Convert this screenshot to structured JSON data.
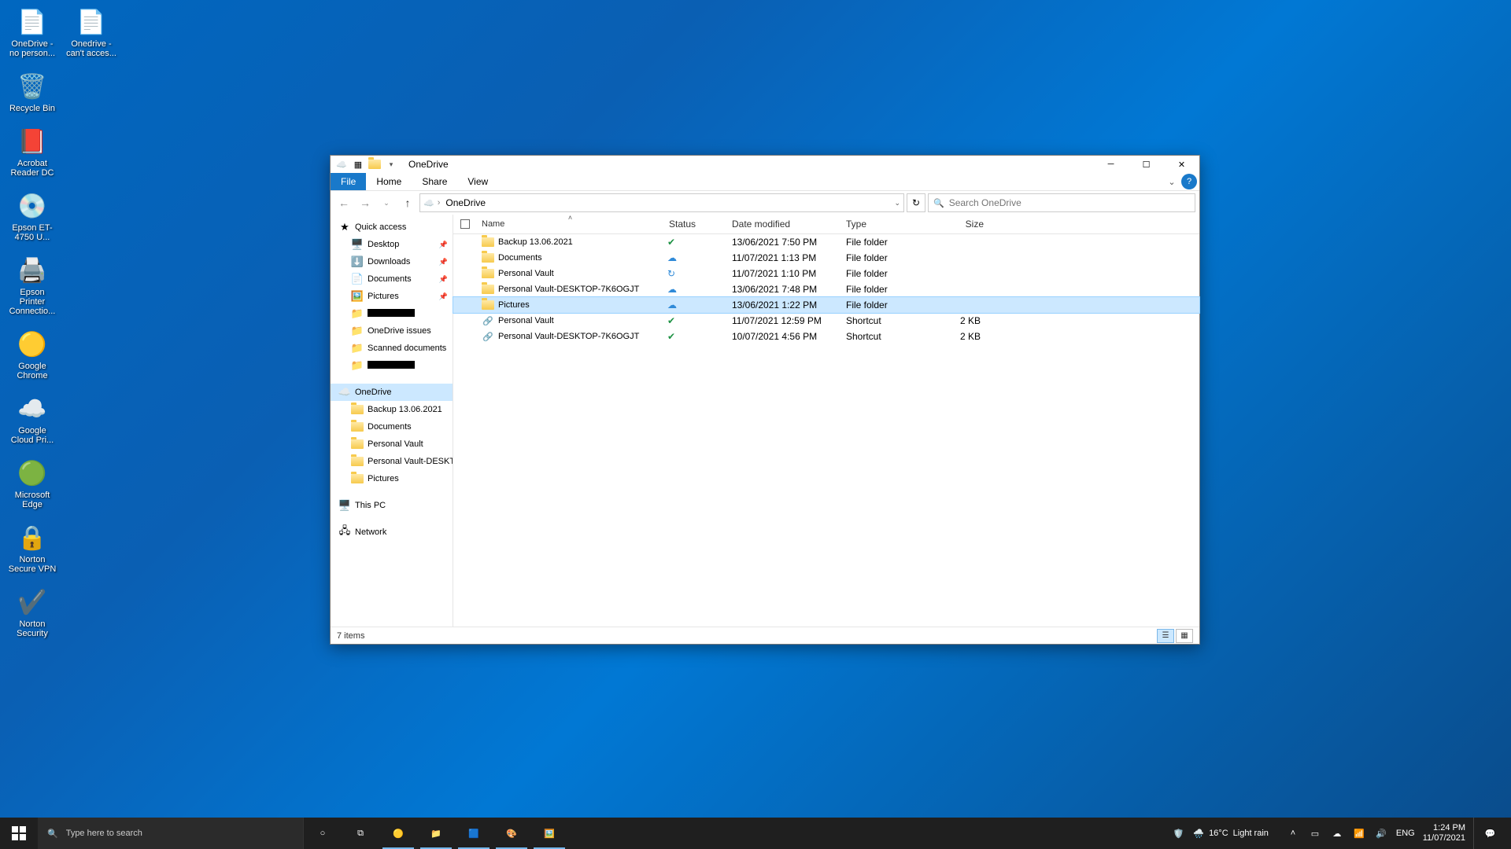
{
  "desktop_icons_col1": [
    {
      "label": "OneDrive - no person...",
      "emoji": "📄"
    },
    {
      "label": "Recycle Bin",
      "emoji": "🗑️"
    },
    {
      "label": "Acrobat Reader DC",
      "emoji": "📕"
    },
    {
      "label": "Epson ET-4750 U...",
      "emoji": "💿"
    },
    {
      "label": "Epson Printer Connectio...",
      "emoji": "🖨️"
    },
    {
      "label": "Google Chrome",
      "emoji": "🟡"
    },
    {
      "label": "Google Cloud Pri...",
      "emoji": "☁️"
    },
    {
      "label": "Microsoft Edge",
      "emoji": "🟢"
    },
    {
      "label": "Norton Secure VPN",
      "emoji": "🔒"
    },
    {
      "label": "Norton Security",
      "emoji": "✔️"
    }
  ],
  "desktop_icons_col2": [
    {
      "label": "Onedrive - can't acces...",
      "emoji": "📄"
    }
  ],
  "window": {
    "title": "OneDrive",
    "tabs": {
      "file": "File",
      "home": "Home",
      "share": "Share",
      "view": "View"
    },
    "breadcrumb": "OneDrive",
    "search_placeholder": "Search OneDrive",
    "columns": {
      "name": "Name",
      "status": "Status",
      "date": "Date modified",
      "type": "Type",
      "size": "Size"
    },
    "rows": [
      {
        "name": "Backup 13.06.2021",
        "icon": "folder",
        "status": "✔",
        "status_color": "#1f9245",
        "date": "13/06/2021 7:50 PM",
        "type": "File folder",
        "size": ""
      },
      {
        "name": "Documents",
        "icon": "folder",
        "status": "☁",
        "status_color": "#2f8ad8",
        "date": "11/07/2021 1:13 PM",
        "type": "File folder",
        "size": ""
      },
      {
        "name": "Personal Vault",
        "icon": "folder",
        "status": "↻",
        "status_color": "#2f8ad8",
        "date": "11/07/2021 1:10 PM",
        "type": "File folder",
        "size": ""
      },
      {
        "name": "Personal Vault-DESKTOP-7K6OGJT",
        "icon": "folder",
        "status": "☁",
        "status_color": "#2f8ad8",
        "date": "13/06/2021 7:48 PM",
        "type": "File folder",
        "size": ""
      },
      {
        "name": "Pictures",
        "icon": "folder",
        "status": "☁",
        "status_color": "#2f8ad8",
        "date": "13/06/2021 1:22 PM",
        "type": "File folder",
        "size": "",
        "selected": true
      },
      {
        "name": "Personal Vault",
        "icon": "shortcut",
        "status": "✔",
        "status_color": "#1f9245",
        "date": "11/07/2021 12:59 PM",
        "type": "Shortcut",
        "size": "2 KB"
      },
      {
        "name": "Personal Vault-DESKTOP-7K6OGJT",
        "icon": "shortcut",
        "status": "✔",
        "status_color": "#1f9245",
        "date": "10/07/2021 4:56 PM",
        "type": "Shortcut",
        "size": "2 KB"
      }
    ],
    "sidebar": {
      "quick_access": "Quick access",
      "qa_items": [
        {
          "label": "Desktop",
          "pin": true,
          "emoji": "🖥️"
        },
        {
          "label": "Downloads",
          "pin": true,
          "emoji": "⬇️"
        },
        {
          "label": "Documents",
          "pin": true,
          "emoji": "📄"
        },
        {
          "label": "Pictures",
          "pin": true,
          "emoji": "🖼️"
        },
        {
          "label": "[redacted]",
          "pin": false,
          "emoji": "📁",
          "redacted": true
        },
        {
          "label": "OneDrive issues",
          "pin": false,
          "emoji": "📁"
        },
        {
          "label": "Scanned documents",
          "pin": false,
          "emoji": "📁"
        },
        {
          "label": "[redacted]",
          "pin": false,
          "emoji": "📁",
          "redacted": true
        }
      ],
      "onedrive": "OneDrive",
      "od_items": [
        {
          "label": "Backup 13.06.2021"
        },
        {
          "label": "Documents"
        },
        {
          "label": "Personal Vault"
        },
        {
          "label": "Personal Vault-DESKTOP"
        },
        {
          "label": "Pictures"
        }
      ],
      "this_pc": "This PC",
      "network": "Network"
    },
    "status": "7 items"
  },
  "taskbar": {
    "search_placeholder": "Type here to search",
    "weather_temp": "16°C",
    "weather_desc": "Light rain",
    "lang": "ENG",
    "time": "1:24 PM",
    "date": "11/07/2021"
  }
}
